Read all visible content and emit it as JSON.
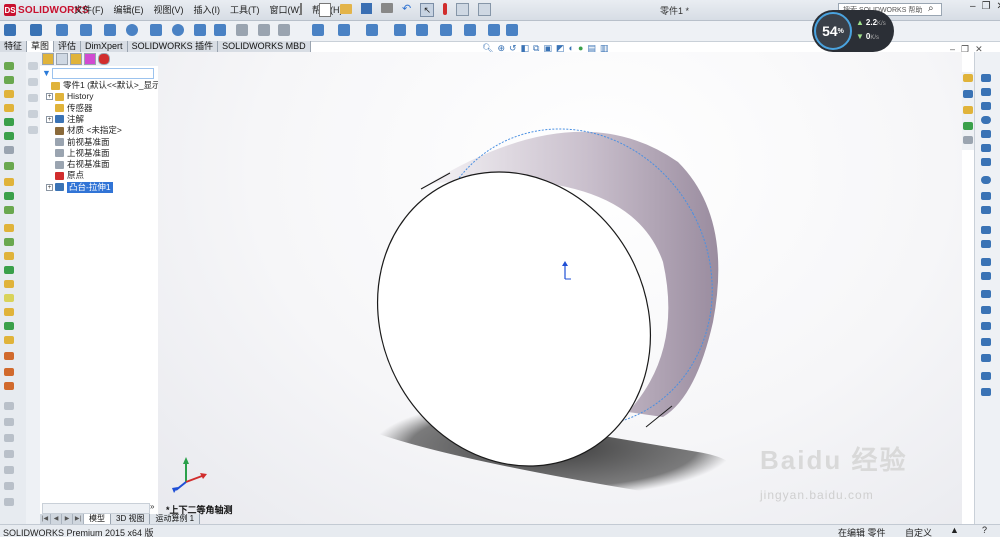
{
  "app": {
    "brand": "SOLIDWORKS",
    "document_title": "零件1 *",
    "search_placeholder": "搜索 SOLIDWORKS 帮助"
  },
  "menu": [
    "文件(F)",
    "编辑(E)",
    "视图(V)",
    "插入(I)",
    "工具(T)",
    "窗口(W)",
    "帮助(H)"
  ],
  "perf_widget": {
    "percent": "54",
    "percent_unit": "%",
    "upload": "2.2",
    "upload_unit": "K/s",
    "download": "0",
    "download_unit": "K/s"
  },
  "command_tabs": [
    "特征",
    "草图",
    "评估",
    "DimXpert",
    "SOLIDWORKS 插件",
    "SOLIDWORKS MBD"
  ],
  "active_command_tab": "草图",
  "feature_tree": {
    "items": [
      {
        "label": "零件1 (默认<<默认>_显示状",
        "expand": "",
        "icon": "part-icon",
        "indent": 0
      },
      {
        "label": "History",
        "expand": "+",
        "icon": "history-folder-icon",
        "indent": 1
      },
      {
        "label": "传感器",
        "expand": "",
        "icon": "sensor-folder-icon",
        "indent": 1
      },
      {
        "label": "注解",
        "expand": "+",
        "icon": "annotation-icon",
        "indent": 1
      },
      {
        "label": "材质 <未指定>",
        "expand": "",
        "icon": "material-icon",
        "indent": 1
      },
      {
        "label": "前视基准面",
        "expand": "",
        "icon": "plane-icon",
        "indent": 1
      },
      {
        "label": "上视基准面",
        "expand": "",
        "icon": "plane-icon",
        "indent": 1
      },
      {
        "label": "右视基准面",
        "expand": "",
        "icon": "plane-icon",
        "indent": 1
      },
      {
        "label": "原点",
        "expand": "",
        "icon": "origin-icon",
        "indent": 1
      },
      {
        "label": "凸台-拉伸1",
        "expand": "+",
        "icon": "extrude-icon",
        "indent": 1,
        "selected": true
      }
    ]
  },
  "model_tabs": [
    "模型",
    "3D 视图",
    "运动算例 1"
  ],
  "active_model_tab": "模型",
  "view_name": "*上下二等角轴测",
  "status": {
    "left": "SOLIDWORKS Premium 2015 x64 版",
    "middle": "在编辑 零件",
    "right": "自定义"
  },
  "watermark": {
    "text": "Baidu 经验",
    "url": "jingyan.baidu.com"
  },
  "colors": {
    "accent": "#3174d6",
    "brand_red": "#c8102e",
    "edge_highlight": "#4a90e2",
    "shadow": "#333333",
    "side_face": "#a89aac"
  }
}
